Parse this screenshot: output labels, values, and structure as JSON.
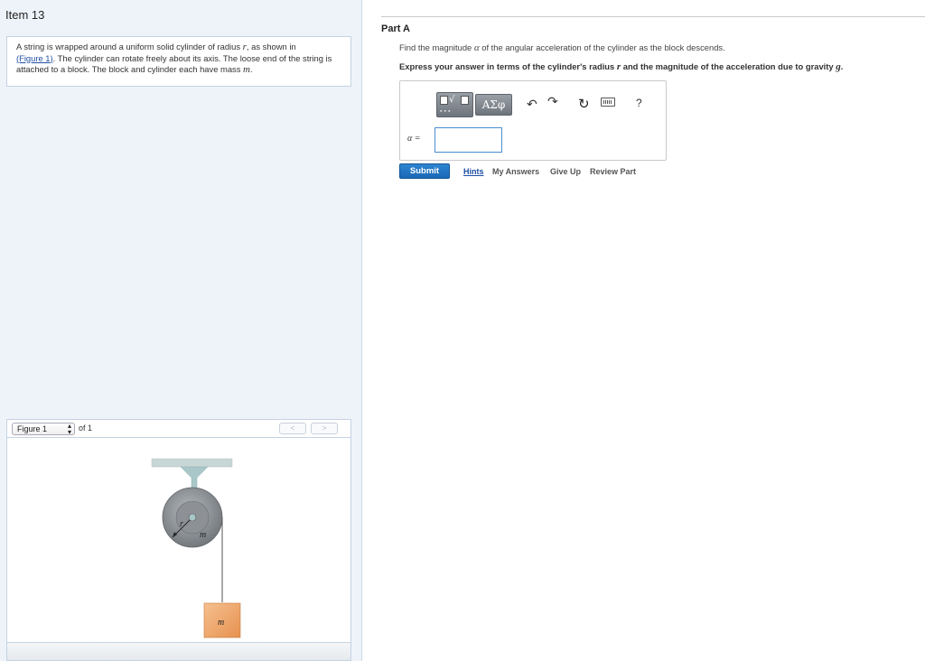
{
  "item": {
    "title": "Item 13"
  },
  "problem": {
    "text_1": "A string is wrapped around a uniform solid cylinder of radius ",
    "var_r": "r",
    "text_2": ", as shown in",
    "figure_link": "(Figure 1)",
    "text_3": ". The cylinder can rotate freely about its axis. The loose end of the string is attached to a block. The block and cylinder each have mass ",
    "var_m": "m",
    "text_4": "."
  },
  "figure": {
    "selector_value": "Figure 1",
    "of_label": "of 1",
    "prev_label": "<",
    "next_label": ">",
    "cylinder_label": "m",
    "radius_label": "r",
    "block_label": "m",
    "colors": {
      "ceiling": "#c9d6d6",
      "bracket": "#a9c7c9",
      "cylinder": "#8a8e93",
      "block": "#eea86e",
      "string": "#555555"
    }
  },
  "part": {
    "title": "Part A",
    "question_1": "Find the magnitude ",
    "question_var": "α",
    "question_2": " of the angular acceleration of the cylinder as the block descends.",
    "instruction_1": "Express your answer in terms of the cylinder's radius ",
    "instruction_var_r": "r",
    "instruction_2": " and the magnitude of the acceleration due to gravity ",
    "instruction_var_g": "g",
    "instruction_3": "."
  },
  "answer": {
    "toolbar": {
      "templates_icon": "templates-icon",
      "templates_symbol": "√",
      "greek_label": "ΑΣφ",
      "undo_icon": "↶",
      "redo_icon": "↷",
      "reset_icon": "↻",
      "keyboard_icon": "keyboard-icon",
      "help_label": "?"
    },
    "variable_label": "α =",
    "value": ""
  },
  "actions": {
    "submit": "Submit",
    "hints": "Hints",
    "my_answers": "My Answers",
    "give_up": "Give Up",
    "review_part": "Review Part"
  }
}
